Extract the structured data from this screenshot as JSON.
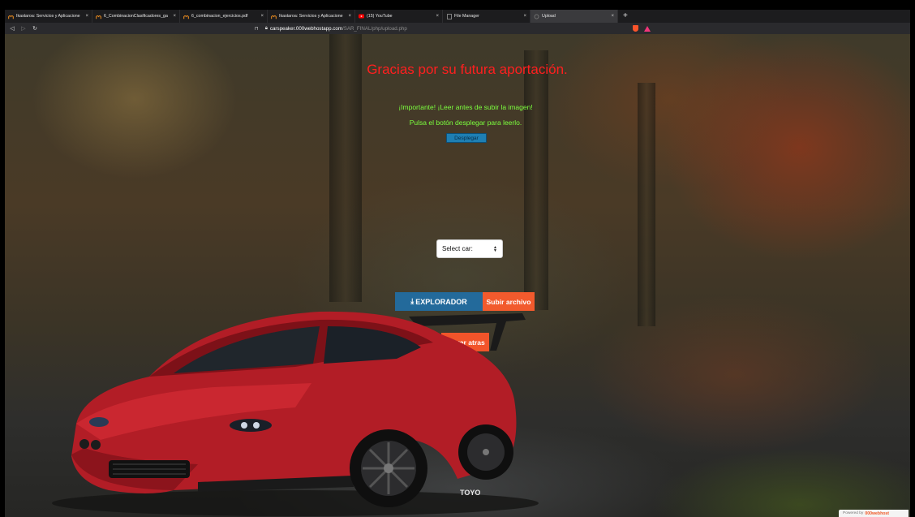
{
  "browser": {
    "tabs": [
      {
        "title": "Ikastaroa: Servicios y Aplicacione",
        "favicon": "moodle-icon",
        "active": false
      },
      {
        "title": "6_CombinacionClasificadores_ga",
        "favicon": "moodle-icon",
        "active": false
      },
      {
        "title": "6_combinacion_ejercicios.pdf",
        "favicon": "moodle-icon",
        "active": false
      },
      {
        "title": "Ikastaroa: Servicios y Aplicacione",
        "favicon": "moodle-icon",
        "active": false
      },
      {
        "title": "(15) YouTube",
        "favicon": "youtube-icon",
        "active": false
      },
      {
        "title": "File Manager",
        "favicon": "generic-page-icon",
        "active": false
      },
      {
        "title": "Upload",
        "favicon": "loading-icon",
        "active": true
      }
    ],
    "tab_close": "×",
    "new_tab": "+",
    "url_host": "carspeaker.000webhostapp.com",
    "url_path": "/SAR_FINAL/php/upload.php"
  },
  "page": {
    "headline": "Gracias por su futura aportación.",
    "important": "¡Importante! ¡Leer antes de subir la imagen!",
    "hint": "Pulsa el botón desplegar para leerlo.",
    "toggle_label": "Desplegar",
    "select_value": "Select car:",
    "explorer_label": "EXPLORADOR",
    "upload_label": "Subir archivo",
    "back_label": "Volver atras",
    "powered_by": "Powered by",
    "powered_brand": "000webhost",
    "plate_text": "TOYO"
  },
  "colors": {
    "headline": "#ff1f1f",
    "notice": "#7cff3e",
    "primary_button": "#236a9b",
    "accent_button": "#f25a2d"
  }
}
